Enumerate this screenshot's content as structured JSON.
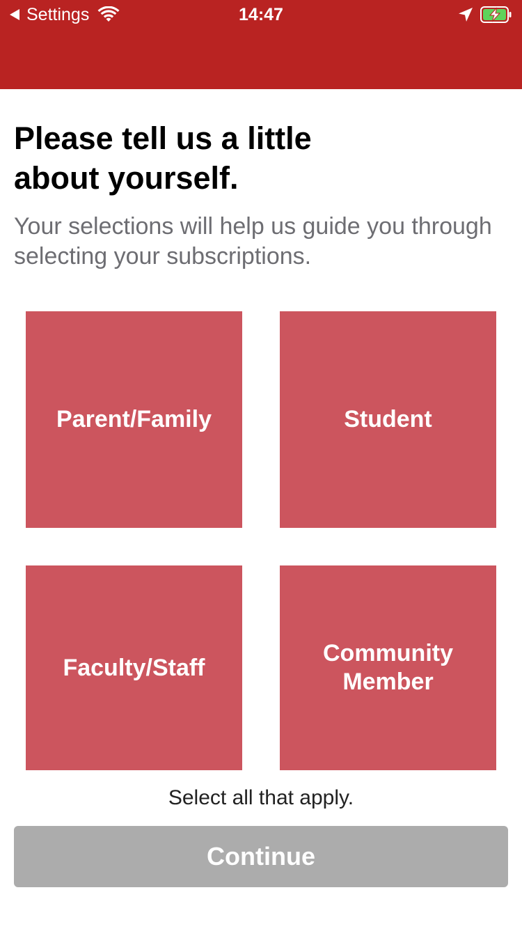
{
  "status_bar": {
    "back_label": "Settings",
    "time": "14:47",
    "icons": [
      "back-arrow-icon",
      "wifi-icon",
      "location-arrow-icon",
      "battery-charging-icon"
    ]
  },
  "header": {
    "bar_color": "#b92322"
  },
  "intro": {
    "title": "Please tell us a little about yourself.",
    "subtitle": "Your selections will help us guide you through selecting your subscriptions."
  },
  "options": [
    {
      "label": "Parent/Family",
      "selected": false
    },
    {
      "label": "Student",
      "selected": false
    },
    {
      "label": "Faculty/Staff",
      "selected": false
    },
    {
      "label": "Community\nMember",
      "selected": false
    }
  ],
  "tile_color": "#cc555e",
  "hint": "Select all that apply.",
  "continue_button": {
    "label": "Continue",
    "enabled": false,
    "color": "#acacac"
  }
}
